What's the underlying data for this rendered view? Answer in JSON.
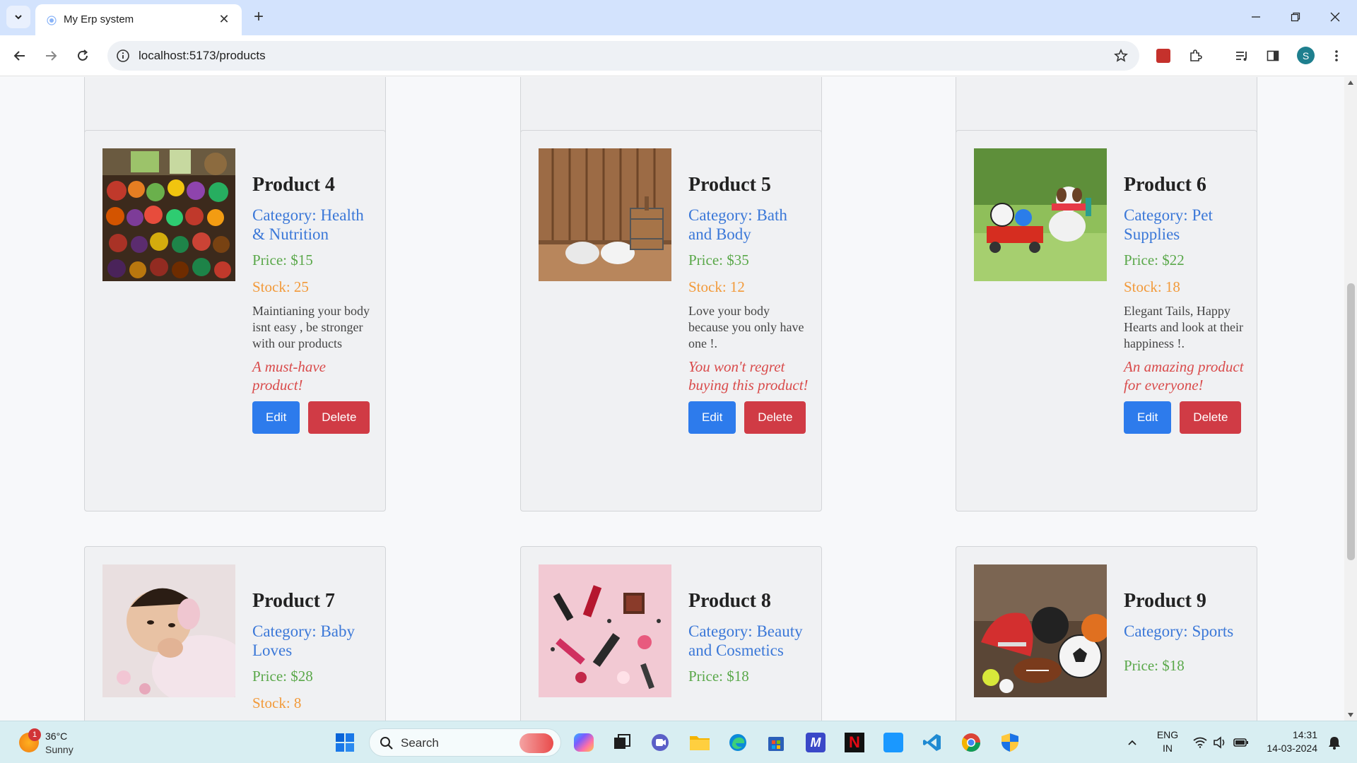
{
  "browser": {
    "tab_title": "My Erp system",
    "url": "localhost:5173/products",
    "profile_initial": "S"
  },
  "products": [
    {
      "name": "Product 4",
      "category": "Category: Health & Nutrition",
      "price": "Price: $15",
      "stock": "Stock: 25",
      "description": "Maintianing your body isnt easy , be stronger with our products",
      "tagline": "A must-have product!",
      "image": "vegetables-market-image"
    },
    {
      "name": "Product 5",
      "category": "Category: Bath and Body",
      "price": "Price: $35",
      "stock": "Stock: 12",
      "description": "Love your body because you only have one !.",
      "tagline": "You won't regret buying this product!",
      "image": "sauna-towels-image"
    },
    {
      "name": "Product 6",
      "category": "Category: Pet Supplies",
      "price": "Price: $22",
      "stock": "Stock: 18",
      "description": "Elegant Tails, Happy Hearts and look at their happiness !.",
      "tagline": "An amazing product for everyone!",
      "image": "dog-toys-image"
    },
    {
      "name": "Product 7",
      "category": "Category: Baby Loves",
      "price": "Price: $28",
      "stock": "Stock: 8",
      "image": "baby-image"
    },
    {
      "name": "Product 8",
      "category": "Category: Beauty and Cosmetics",
      "price": "Price: $18",
      "image": "cosmetics-image"
    },
    {
      "name": "Product 9",
      "category": "Category: Sports",
      "price": "Price: $18",
      "image": "sports-balls-image"
    }
  ],
  "buttons": {
    "edit": "Edit",
    "delete": "Delete"
  },
  "taskbar": {
    "weather_temp": "36°C",
    "weather_condition": "Sunny",
    "notification_count": "1",
    "search_label": "Search",
    "lang_line1": "ENG",
    "lang_line2": "IN",
    "time": "14:31",
    "date": "14-03-2024"
  },
  "colors": {
    "category": "#3b78d8",
    "price": "#5aa84a",
    "stock": "#f29a3a",
    "tagline": "#d94b4b",
    "edit_button": "#2d7bec",
    "delete_button": "#d03b45"
  }
}
